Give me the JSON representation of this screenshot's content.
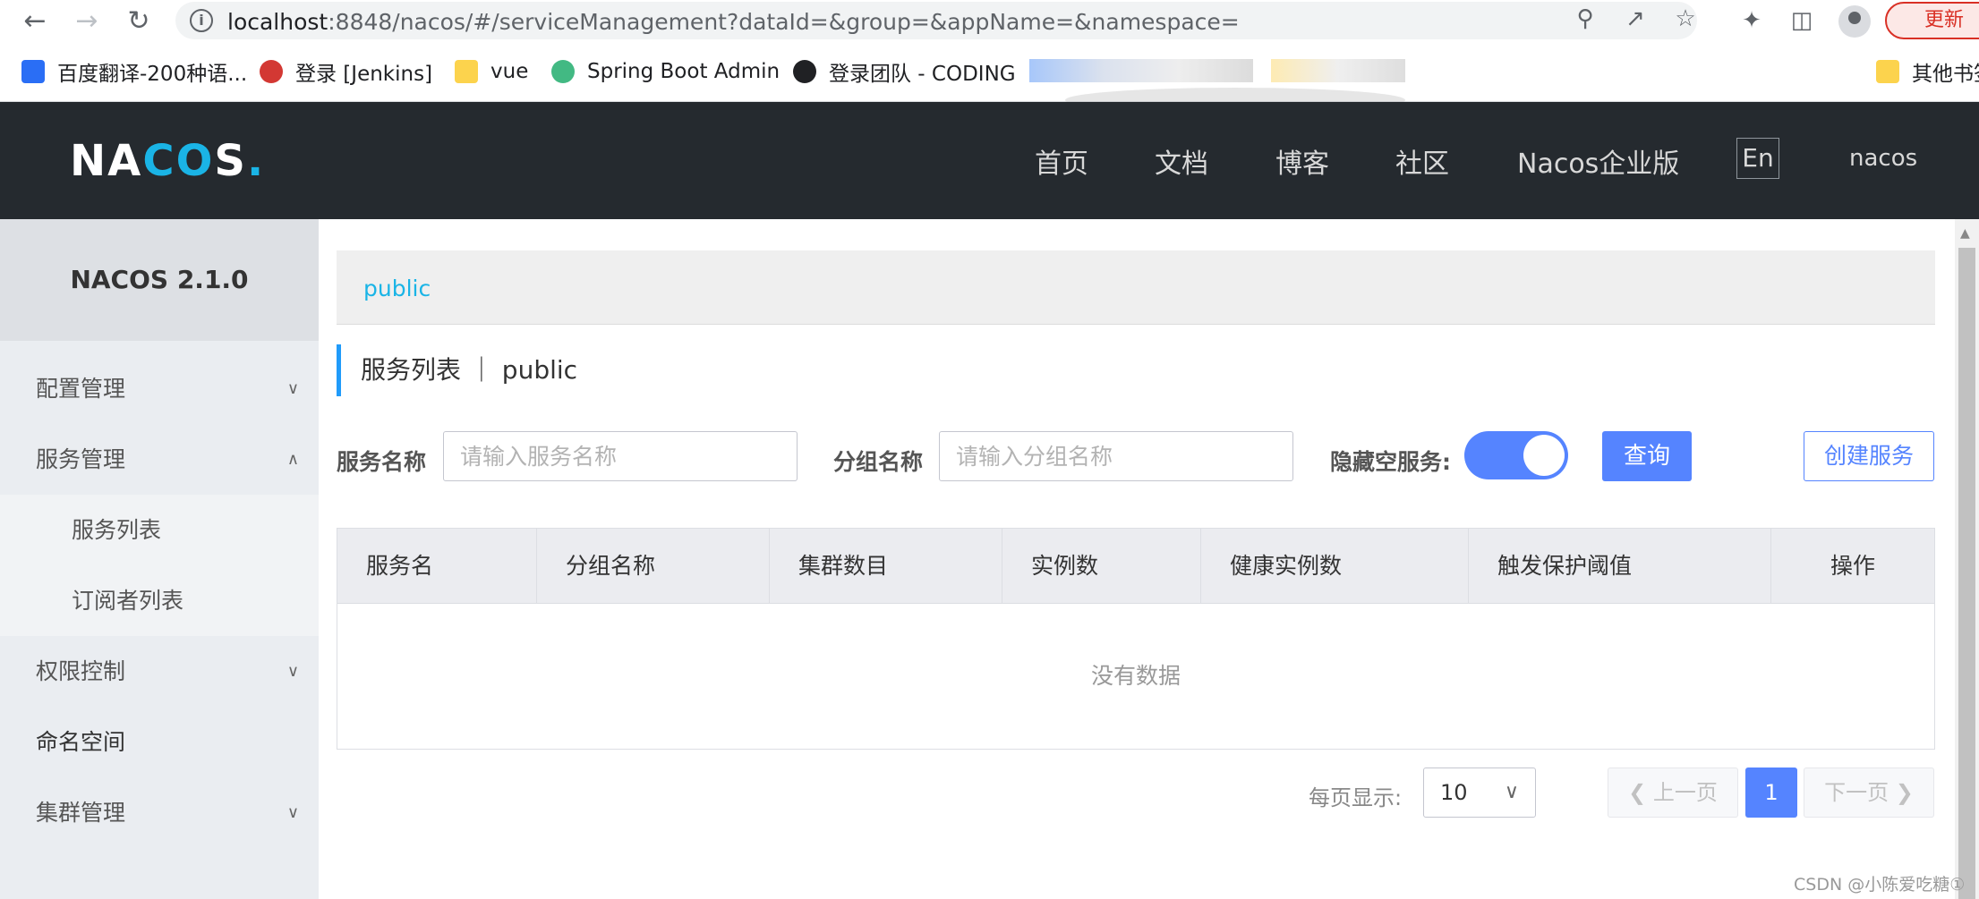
{
  "browser": {
    "url_host": "localhost",
    "url_rest": ":8848/nacos/#/serviceManagement?dataId=&group=&appName=&namespace=",
    "update_label": "更新",
    "bookmarks": [
      {
        "label": "百度翻译-200种语...",
        "icon": "translate-icon",
        "color": "#2a6ef5"
      },
      {
        "label": "登录 [Jenkins]",
        "icon": "jenkins-icon",
        "color": "#d33833"
      },
      {
        "label": "vue",
        "icon": "folder-icon",
        "color": "#fcd34d"
      },
      {
        "label": "Spring Boot Admin",
        "icon": "spring-boot-admin-icon",
        "color": "#42b983"
      },
      {
        "label": "登录团队 - CODING",
        "icon": "coding-icon",
        "color": "#202124"
      }
    ],
    "other_bookmarks": "其他书签"
  },
  "header": {
    "logo": "NACOS.",
    "nav": [
      "首页",
      "文档",
      "博客",
      "社区",
      "Nacos企业版"
    ],
    "lang": "En",
    "user": "nacos"
  },
  "sidebar": {
    "title": "NACOS 2.1.0",
    "items": [
      {
        "label": "配置管理",
        "expanded": false
      },
      {
        "label": "服务管理",
        "expanded": true,
        "children": [
          "服务列表",
          "订阅者列表"
        ]
      },
      {
        "label": "权限控制",
        "expanded": false
      },
      {
        "label": "命名空间"
      },
      {
        "label": "集群管理",
        "expanded": false
      }
    ]
  },
  "main": {
    "namespace": "public",
    "title": "服务列表 ｜ public",
    "search": {
      "service_label": "服务名称",
      "service_placeholder": "请输入服务名称",
      "group_label": "分组名称",
      "group_placeholder": "请输入分组名称",
      "hide_empty_label": "隐藏空服务:",
      "hide_empty_on": true,
      "query_button": "查询",
      "create_button": "创建服务"
    },
    "table": {
      "columns": [
        "服务名",
        "分组名称",
        "集群数目",
        "实例数",
        "健康实例数",
        "触发保护阈值",
        "操作"
      ],
      "empty_text": "没有数据"
    },
    "pagination": {
      "page_size_label": "每页显示:",
      "page_size": "10",
      "prev": "上一页",
      "next": "下一页",
      "current_page": "1"
    }
  },
  "watermark": "CSDN @小陈爱吃糖①",
  "colors": {
    "primary": "#5584ff",
    "header_bg": "#252a2f",
    "accent_cyan": "#1ab4e6"
  }
}
